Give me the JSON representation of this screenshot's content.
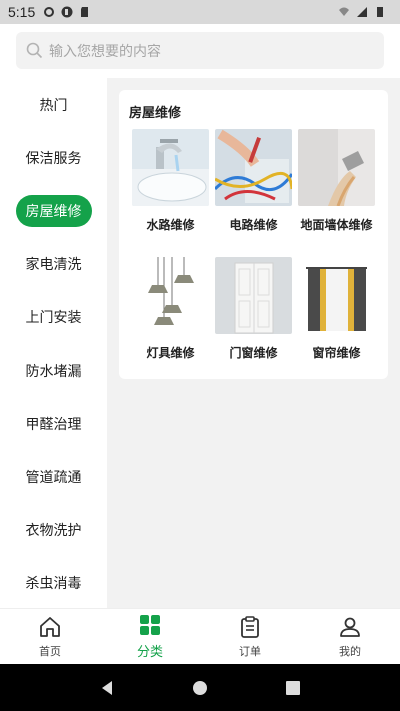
{
  "status": {
    "time": "5:15"
  },
  "search": {
    "placeholder": "输入您想要的内容"
  },
  "sidebar": {
    "items": [
      {
        "label": "热门"
      },
      {
        "label": "保洁服务"
      },
      {
        "label": "房屋维修",
        "active": true
      },
      {
        "label": "家电清洗"
      },
      {
        "label": "上门安装"
      },
      {
        "label": "防水堵漏"
      },
      {
        "label": "甲醛治理"
      },
      {
        "label": "管道疏通"
      },
      {
        "label": "衣物洗护"
      },
      {
        "label": "杀虫消毒"
      }
    ]
  },
  "main": {
    "section_title": "房屋维修",
    "tiles": [
      {
        "label": "水路维修",
        "icon": "faucet-image"
      },
      {
        "label": "电路维修",
        "icon": "wiring-image"
      },
      {
        "label": "地面墙体维修",
        "icon": "wall-paint-image"
      },
      {
        "label": "灯具维修",
        "icon": "pendant-lamp-image"
      },
      {
        "label": "门窗维修",
        "icon": "door-image"
      },
      {
        "label": "窗帘维修",
        "icon": "curtain-image"
      }
    ]
  },
  "tabbar": {
    "tabs": [
      {
        "label": "首页",
        "icon": "home-icon"
      },
      {
        "label": "分类",
        "icon": "grid-icon",
        "active": true
      },
      {
        "label": "订单",
        "icon": "clipboard-icon"
      },
      {
        "label": "我的",
        "icon": "user-icon"
      }
    ]
  },
  "colors": {
    "accent": "#14a24a",
    "panel_bg": "#f2f2f2"
  }
}
